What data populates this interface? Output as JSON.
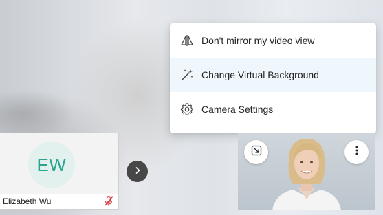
{
  "menu": {
    "items": [
      {
        "label": "Don't mirror my video view",
        "icon": "mirror-icon"
      },
      {
        "label": "Change Virtual Background",
        "icon": "magic-wand-icon"
      },
      {
        "label": "Camera Settings",
        "icon": "gear-icon"
      }
    ],
    "highlighted_index": 1
  },
  "participant": {
    "initials": "EW",
    "name": "Elizabeth Wu",
    "muted": true,
    "avatar_color": "#2ba58f"
  },
  "self_view": {
    "popout_icon": "popout-icon",
    "more_icon": "more-options-icon"
  },
  "nav": {
    "next_icon": "chevron-right-icon"
  },
  "colors": {
    "accent": "#2ba58f",
    "mute": "#d13438",
    "highlight": "#eff6fc"
  }
}
